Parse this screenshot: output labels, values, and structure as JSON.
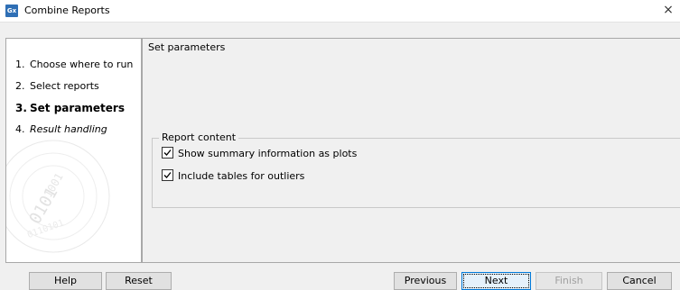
{
  "window": {
    "icon_label": "Gx",
    "title": "Combine Reports",
    "close_glyph": "×"
  },
  "steps": [
    {
      "number": "1.",
      "label": "Choose where to run",
      "state": "normal"
    },
    {
      "number": "2.",
      "label": "Select reports",
      "state": "normal"
    },
    {
      "number": "3.",
      "label": "Set parameters",
      "state": "current"
    },
    {
      "number": "4.",
      "label": "Result handling",
      "state": "italic"
    }
  ],
  "main": {
    "section_title": "Set parameters",
    "group_title": "Report content",
    "options": [
      {
        "label": "Show summary information as plots",
        "checked": true
      },
      {
        "label": "Include tables for outliers",
        "checked": true
      }
    ]
  },
  "buttons": {
    "help": "Help",
    "reset": "Reset",
    "previous": "Previous",
    "next": "Next",
    "finish": "Finish",
    "cancel": "Cancel"
  },
  "colors": {
    "app_icon": "#2f6fb5",
    "focus_border": "#0078d7",
    "disabled_text": "#a0a0a0"
  },
  "icons": {
    "app": "gx-app-icon",
    "close": "close-icon",
    "checkmark": "checkmark-icon",
    "watermark": "binary-watermark-icon"
  }
}
